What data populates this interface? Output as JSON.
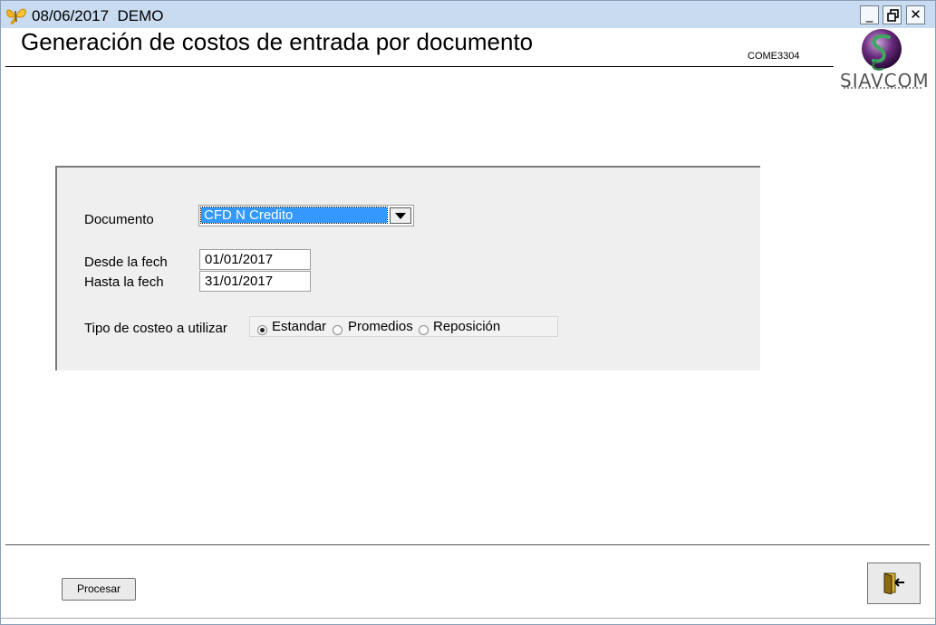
{
  "window": {
    "title": "08/06/2017  DEMO",
    "minimize_label": "_",
    "close_label": "✕"
  },
  "header": {
    "title": "Generación de costos de entrada por documento",
    "form_code": "COME3304",
    "logo_text": "SIAVCOM"
  },
  "form": {
    "documento_label": "Documento",
    "documento_value": "CFD N Credito",
    "desde_label": "Desde la fech",
    "desde_value": "01/01/2017",
    "hasta_label": "Hasta la fech",
    "hasta_value": "31/01/2017",
    "tipo_label": "Tipo de costeo a utilizar",
    "options": [
      {
        "label": "Estandar",
        "selected": true
      },
      {
        "label": "Promedios",
        "selected": false
      },
      {
        "label": "Reposición",
        "selected": false
      }
    ]
  },
  "footer": {
    "procesar_label": "Procesar"
  },
  "colors": {
    "titlebar": "#c9dbf0",
    "selection": "#3399ff",
    "panel": "#efefef"
  },
  "icons": {
    "app": "butterfly-icon",
    "exit": "exit-door-icon",
    "dropdown": "chevron-down-icon"
  }
}
